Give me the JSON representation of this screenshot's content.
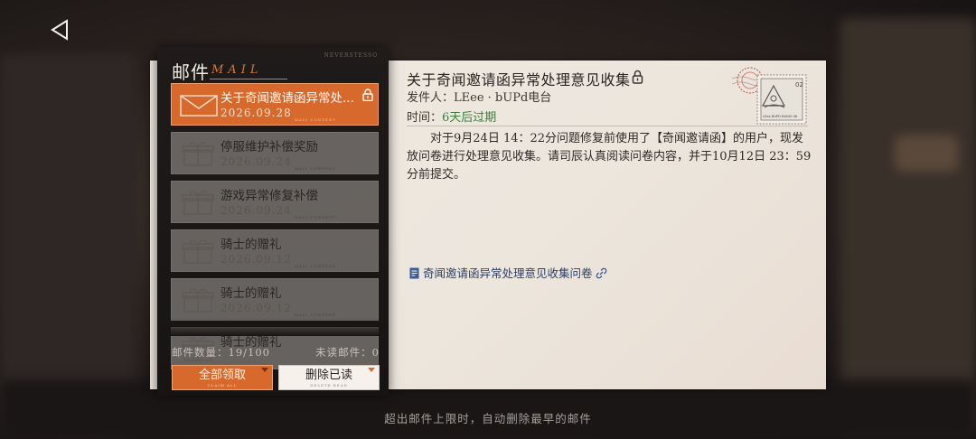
{
  "nav": {
    "back_icon": "back-arrow-icon"
  },
  "panel": {
    "title": "邮件",
    "title_en": "MAIL",
    "tag": "NEVERSTESSO"
  },
  "mails": [
    {
      "title": "关于奇闻邀请函异常处...",
      "date": "2026.09.28",
      "small": "MAIL CONTENT",
      "active": true,
      "locked": true
    },
    {
      "title": "停服维护补偿奖励",
      "date": "2026.09.24",
      "small": "MAIL CONTENT",
      "active": false,
      "locked": false
    },
    {
      "title": "游戏异常修复补偿",
      "date": "2026.09.24",
      "small": "MAIL CONTENT",
      "active": false,
      "locked": false
    },
    {
      "title": "骑士的赠礼",
      "date": "2026.09.12",
      "small": "MAIL CONTENT",
      "active": false,
      "locked": false
    },
    {
      "title": "骑士的赠礼",
      "date": "2026.09.12",
      "small": "MAIL CONTENT",
      "active": false,
      "locked": false
    },
    {
      "title": "骑士的赠礼",
      "date": "",
      "small": "",
      "active": false,
      "locked": false
    }
  ],
  "footer": {
    "count_label": "邮件数量：",
    "count_value": "19/100",
    "unread_label": "未读邮件：",
    "unread_value": "0"
  },
  "buttons": {
    "claim_label": "全部领取",
    "claim_sub": "CLAIM ALL",
    "delete_label": "删除已读",
    "delete_sub": "DELETE READ"
  },
  "letter": {
    "title": "关于奇闻邀请函异常处理意见收集",
    "sender_label": "发件人：",
    "sender": "LEee · bUPd电台",
    "time_label": "时间：",
    "expire": "6天后过期",
    "body": "对于9月24日 14：22分问题修复前使用了【奇闻邀请函】的用户，现发放问卷进行处理意见收集。请司辰认真阅读问卷内容，并于10月12日 23：59分前提交。",
    "link_label": "奇闻邀请函异常处理意见收集问卷",
    "stamp": {
      "value": "02",
      "bottom": "LEee BUPD RADIO 08"
    }
  },
  "hint": "超出邮件上限时，自动删除最早的邮件",
  "colors": {
    "accent": "#d8692d",
    "expire": "#3c7d3c",
    "link": "#2c3f66"
  }
}
